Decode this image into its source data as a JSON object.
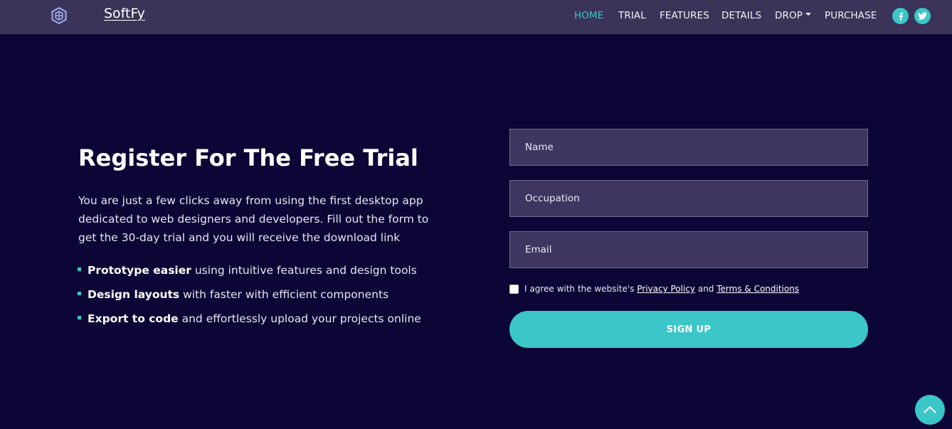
{
  "brand": {
    "name": "SoftFy",
    "logo_icon": "hexagon-logo-icon"
  },
  "nav": {
    "items": [
      {
        "label": "HOME",
        "active": true
      },
      {
        "label": "TRIAL",
        "active": false
      },
      {
        "label": "FEATURES",
        "active": false
      },
      {
        "label": "DETAILS",
        "active": false
      },
      {
        "label": "DROP",
        "active": false,
        "dropdown": true
      },
      {
        "label": "PURCHASE",
        "active": false
      }
    ],
    "social": [
      "facebook-icon",
      "twitter-icon"
    ]
  },
  "hero": {
    "heading": "Register For The Free Trial",
    "intro": "You are just a few clicks away from using the first desktop app dedicated to web designers and developers. Fill out the form to get the 30-day trial and you will receive the download link",
    "bullets": [
      {
        "bold": "Prototype easier",
        "rest": " using intuitive features and design tools"
      },
      {
        "bold": "Design layouts",
        "rest": " with faster with efficient components"
      },
      {
        "bold": "Export to code",
        "rest": " and effortlessly upload your projects online"
      }
    ]
  },
  "form": {
    "name_placeholder": "Name",
    "occupation_placeholder": "Occupation",
    "email_placeholder": "Email",
    "agree_text": "I agree with the website's",
    "privacy_link": "Privacy Policy",
    "and_text": "and",
    "terms_link": "Terms & Conditions",
    "submit_label": "SIGN UP"
  },
  "colors": {
    "accent": "#3cc6c8",
    "navbar": "#3b3458",
    "background": "#0b0635",
    "field": "#3e3660"
  },
  "scroll_top": {
    "icon": "chevron-up-icon"
  }
}
